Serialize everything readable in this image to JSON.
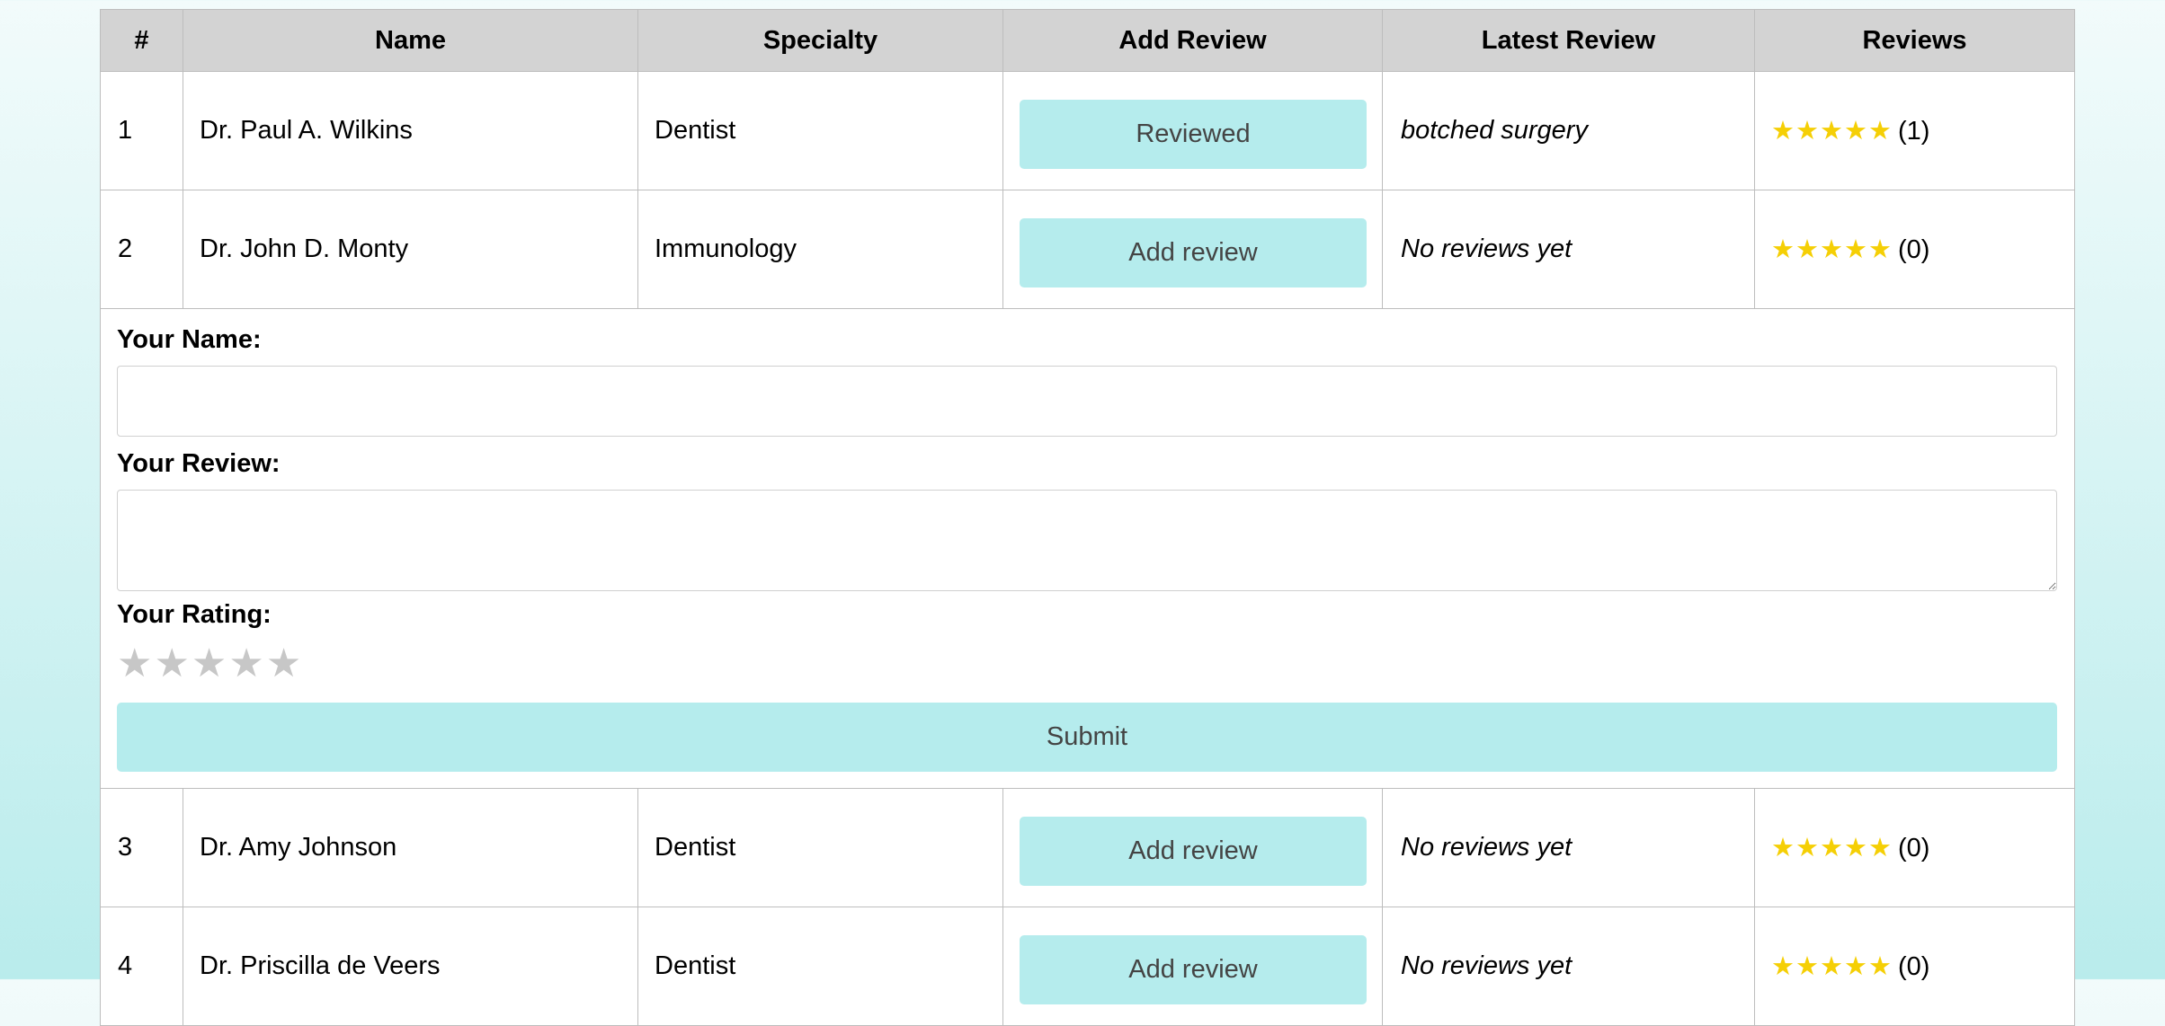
{
  "table": {
    "headers": [
      "#",
      "Name",
      "Specialty",
      "Add Review",
      "Latest Review",
      "Reviews"
    ],
    "rows": [
      {
        "num": "1",
        "name": "Dr. Paul A. Wilkins",
        "specialty": "Dentist",
        "button": "Reviewed",
        "latest": "botched surgery",
        "stars": "★★★★★",
        "count": "(1)"
      },
      {
        "num": "2",
        "name": "Dr. John D. Monty",
        "specialty": "Immunology",
        "button": "Add review",
        "latest": "No reviews yet",
        "stars": "★★★★★",
        "count": "(0)"
      },
      {
        "num": "3",
        "name": "Dr. Amy Johnson",
        "specialty": "Dentist",
        "button": "Add review",
        "latest": "No reviews yet",
        "stars": "★★★★★",
        "count": "(0)"
      },
      {
        "num": "4",
        "name": "Dr. Priscilla de Veers",
        "specialty": "Dentist",
        "button": "Add review",
        "latest": "No reviews yet",
        "stars": "★★★★★",
        "count": "(0)"
      }
    ]
  },
  "form": {
    "name_label": "Your Name:",
    "name_value": "",
    "review_label": "Your Review:",
    "review_value": "",
    "rating_label": "Your Rating:",
    "rating_stars": [
      "★",
      "★",
      "★",
      "★",
      "★"
    ],
    "submit_label": "Submit"
  },
  "colors": {
    "button_bg": "#b5eced",
    "star_filled": "#f5cf05",
    "star_empty": "#c7c7c7",
    "header_bg": "#d3d3d3"
  }
}
